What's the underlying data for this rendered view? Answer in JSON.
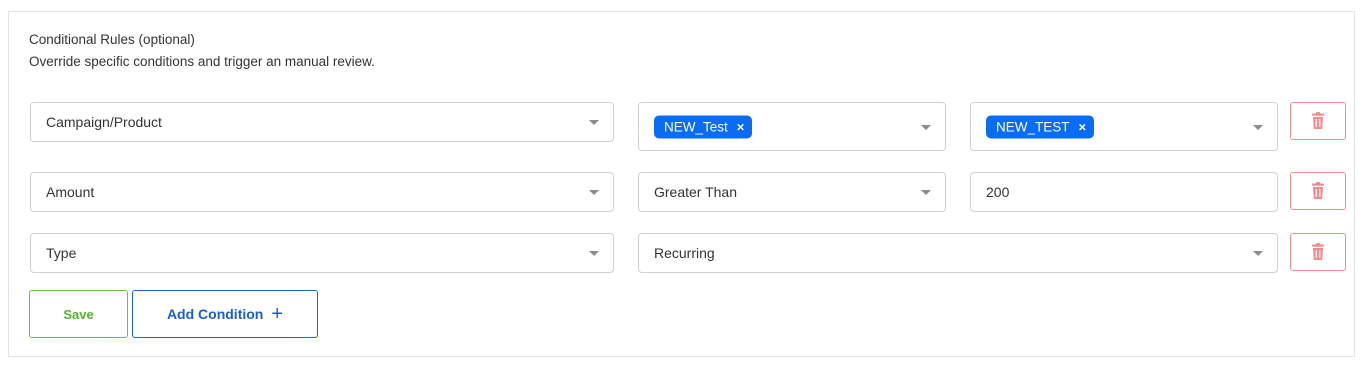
{
  "header": {
    "title": "Conditional Rules (optional)",
    "subtitle": "Override specific conditions and trigger an manual review."
  },
  "rules": [
    {
      "field": "Campaign/Product",
      "operator_tag": "NEW_Test",
      "value_tag": "NEW_TEST"
    },
    {
      "field": "Amount",
      "operator": "Greater Than",
      "value": "200"
    },
    {
      "field": "Type",
      "value": "Recurring"
    }
  ],
  "actions": {
    "save_label": "Save",
    "add_condition_label": "Add Condition",
    "add_icon": "+"
  },
  "icons": {
    "remove_tag": "×",
    "dropdown": "chevron-down-icon",
    "delete": "trash-icon"
  },
  "colors": {
    "tag_bg": "#0a6cf5",
    "delete": "#f08c8c",
    "save": "#52b52a",
    "add": "#1a5fd1"
  }
}
